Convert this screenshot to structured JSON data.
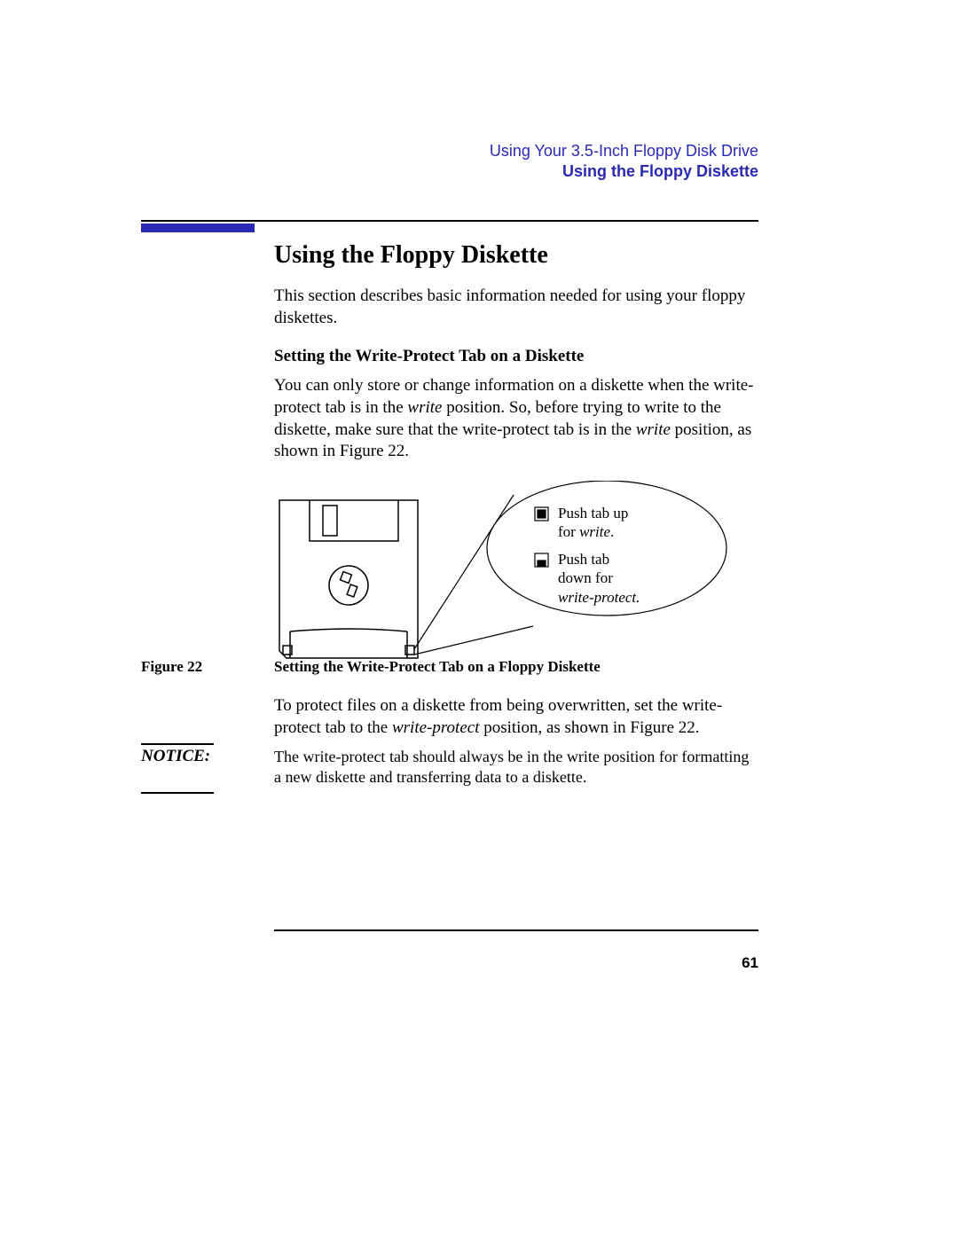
{
  "header": {
    "chapter": "Using Your 3.5-Inch Floppy Disk Drive",
    "section": "Using the Floppy Diskette"
  },
  "main": {
    "title": "Using the Floppy Diskette",
    "intro": "This section describes basic information needed for using your floppy diskettes.",
    "subheading": "Setting the Write-Protect Tab on a Diskette",
    "para1_a": "You can only store or change information on a diskette when the write-protect tab is in the ",
    "para1_write1": "write",
    "para1_b": " position. So, before trying to write to the diskette, make sure that the write-protect tab is in the ",
    "para1_write2": "write",
    "para1_c": " position, as shown in Figure 22."
  },
  "figure": {
    "bubble1_a": "Push tab up",
    "bubble1_b": "for ",
    "bubble1_c": "write",
    "bubble1_d": ".",
    "bubble2_a": "Push tab",
    "bubble2_b": "down for",
    "bubble2_c": "write-protect."
  },
  "caption": {
    "label": "Figure 22",
    "text": "Setting the Write-Protect Tab on a Floppy Diskette"
  },
  "after": {
    "a": "To protect files on a diskette from being overwritten, set the write-protect tab to the ",
    "b": "write-protect",
    "c": " position, as shown in Figure 22."
  },
  "notice": {
    "label": "NOTICE:",
    "text": "The write-protect tab should always be in the write position for formatting a new diskette and transferring data to a diskette."
  },
  "pageNumber": "61"
}
